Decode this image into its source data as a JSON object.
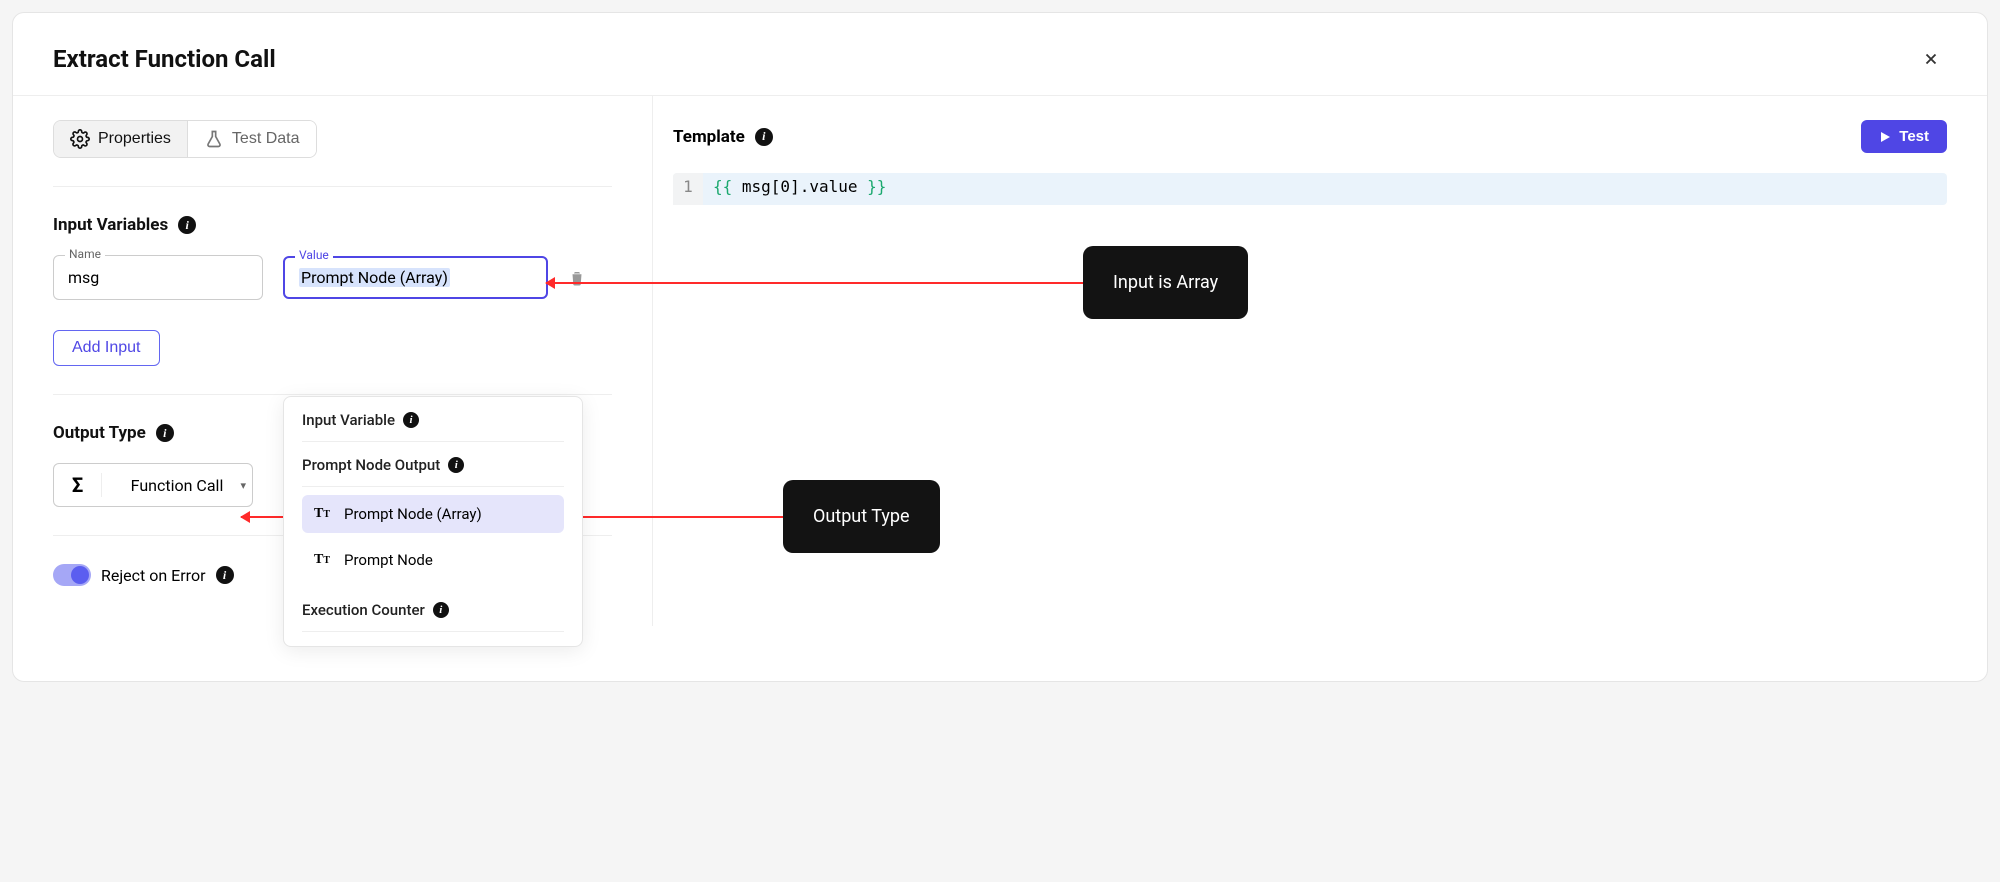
{
  "header": {
    "title": "Extract Function Call"
  },
  "tabs": {
    "properties": "Properties",
    "testdata": "Test Data"
  },
  "inputVariables": {
    "heading": "Input Variables",
    "nameLabel": "Name",
    "valueLabel": "Value",
    "row": {
      "name": "msg",
      "value": "Prompt Node (Array)"
    },
    "addButton": "Add Input"
  },
  "outputType": {
    "heading": "Output Type",
    "selected": "Function Call"
  },
  "rejectToggle": {
    "label": "Reject on Error",
    "on": true
  },
  "dropdown": {
    "groups": [
      {
        "label": "Input Variable",
        "items": []
      },
      {
        "label": "Prompt Node Output",
        "items": [
          {
            "label": "Prompt Node (Array)",
            "selected": true
          },
          {
            "label": "Prompt Node",
            "selected": false
          }
        ]
      },
      {
        "label": "Execution Counter",
        "items": []
      }
    ]
  },
  "template": {
    "heading": "Template",
    "code": {
      "lineNumber": "1",
      "open": "{{",
      "expr": " msg[0].value ",
      "close": "}}"
    },
    "testButton": "Test"
  },
  "callouts": {
    "inputIsArray": "Input is Array",
    "outputType": "Output Type"
  }
}
